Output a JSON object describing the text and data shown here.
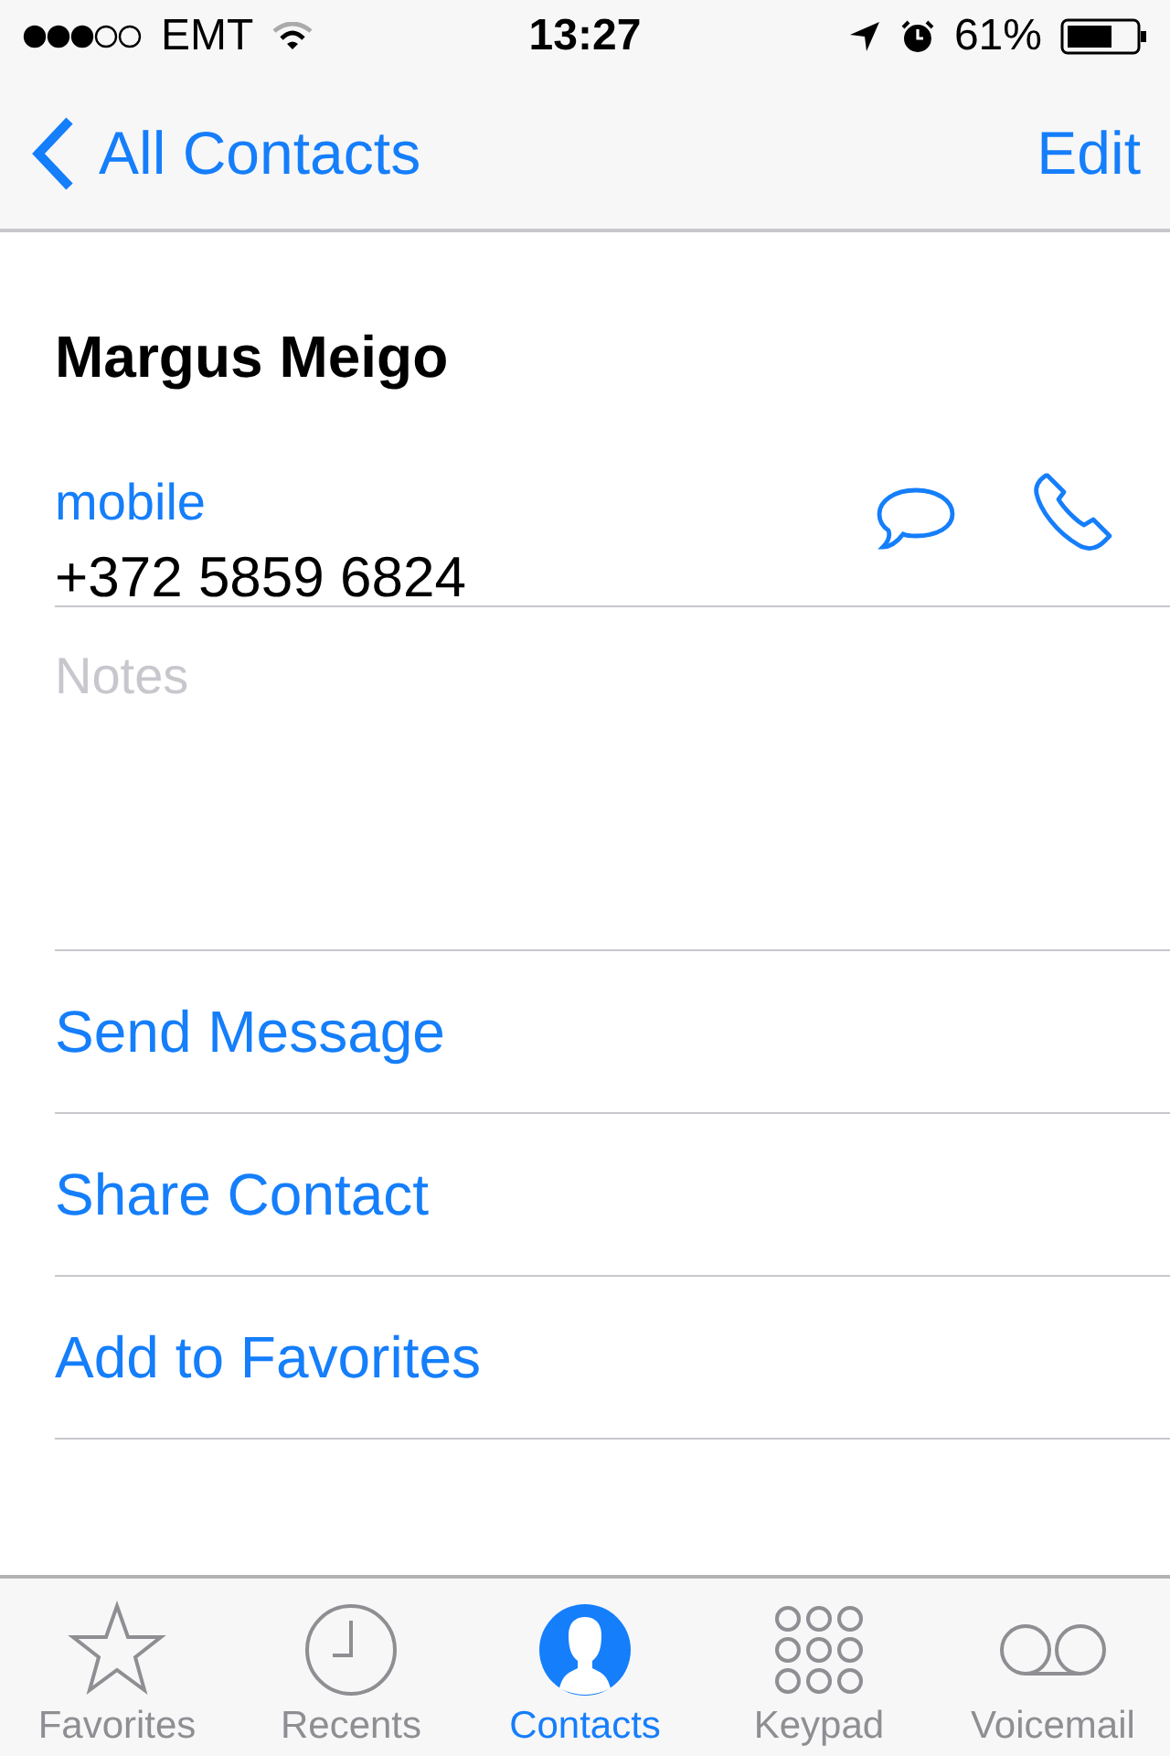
{
  "status_bar": {
    "carrier": "EMT",
    "time": "13:27",
    "battery": "61%"
  },
  "nav": {
    "back": "All Contacts",
    "action": "Edit"
  },
  "contact": {
    "name": "Margus Meigo"
  },
  "phone": {
    "label": "mobile",
    "number": "+372 5859 6824"
  },
  "notes": {
    "placeholder": "Notes"
  },
  "actions": [
    "Send Message",
    "Share Contact",
    "Add to Favorites"
  ],
  "tabs": [
    {
      "kind": "star",
      "label": "Favorites",
      "selected": false
    },
    {
      "kind": "clock",
      "label": "Recents",
      "selected": false
    },
    {
      "kind": "person",
      "label": "Contacts",
      "selected": true
    },
    {
      "kind": "keypad",
      "label": "Keypad",
      "selected": false
    },
    {
      "kind": "voicemail",
      "label": "Voicemail",
      "selected": false
    }
  ]
}
